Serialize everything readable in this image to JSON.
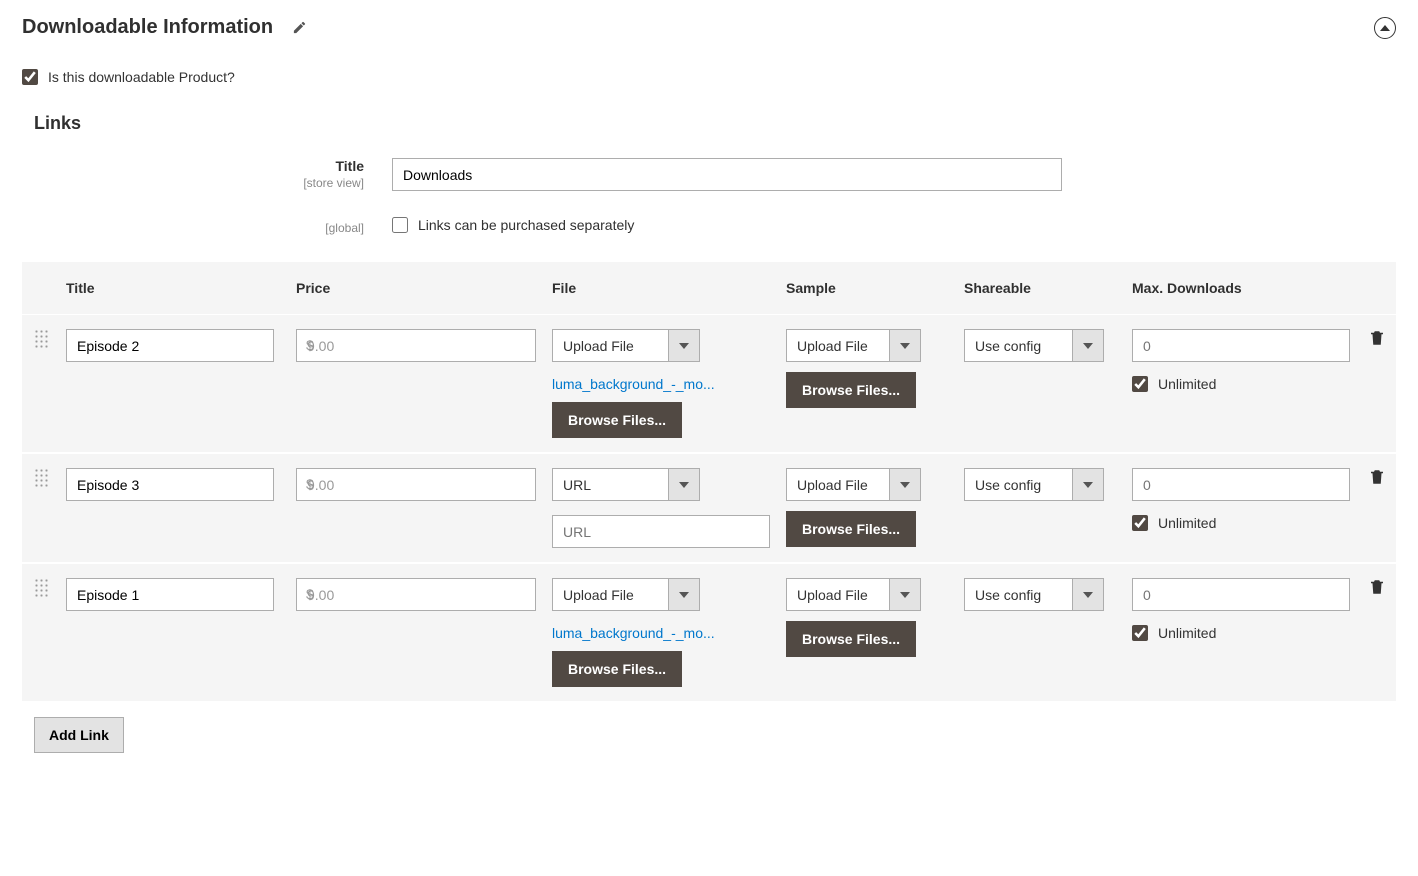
{
  "section": {
    "title": "Downloadable Information",
    "is_downloadable_label": "Is this downloadable Product?",
    "is_downloadable_checked": true
  },
  "links": {
    "heading": "Links",
    "title_label": "Title",
    "title_scope": "[store view]",
    "title_value": "Downloads",
    "separate_scope": "[global]",
    "separate_label": "Links can be purchased separately",
    "separate_checked": false,
    "add_link_label": "Add Link"
  },
  "table": {
    "headers": {
      "title": "Title",
      "price": "Price",
      "file": "File",
      "sample": "Sample",
      "shareable": "Shareable",
      "max": "Max. Downloads"
    }
  },
  "rows": [
    {
      "title": "Episode 2",
      "price": "9.00",
      "file_mode": "Upload File",
      "file_name": "luma_background_-_mo...",
      "file_browse": "Browse Files...",
      "sample_mode": "Upload File",
      "sample_browse": "Browse Files...",
      "shareable": "Use config",
      "max_placeholder": "0",
      "unlimited_label": "Unlimited",
      "unlimited_checked": true
    },
    {
      "title": "Episode 3",
      "price": "9.00",
      "file_mode": "URL",
      "url_placeholder": "URL",
      "sample_mode": "Upload File",
      "sample_browse": "Browse Files...",
      "shareable": "Use config",
      "max_placeholder": "0",
      "unlimited_label": "Unlimited",
      "unlimited_checked": true
    },
    {
      "title": "Episode 1",
      "price": "9.00",
      "file_mode": "Upload File",
      "file_name": "luma_background_-_mo...",
      "file_browse": "Browse Files...",
      "sample_mode": "Upload File",
      "sample_browse": "Browse Files...",
      "shareable": "Use config",
      "max_placeholder": "0",
      "unlimited_label": "Unlimited",
      "unlimited_checked": true
    }
  ],
  "currency_symbol": "$"
}
